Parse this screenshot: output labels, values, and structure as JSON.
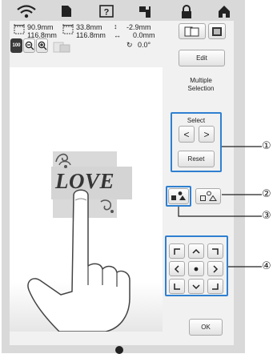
{
  "status_bar": {
    "icons": [
      "wifi-icon",
      "page-icon",
      "help-icon",
      "thread-icon",
      "lock-icon",
      "home-icon"
    ]
  },
  "info": {
    "width_label": "90.9mm",
    "height_label": "116.8mm",
    "width2_label": "33.8mm",
    "height2_label": "116.8mm",
    "offset_y": "-2.9mm",
    "offset_x": "0.0mm",
    "rotation": "0.0°"
  },
  "zoom": {
    "level_label": "100"
  },
  "buttons": {
    "edit": "Edit",
    "multiple_selection": "Multiple\nSelection",
    "select_title": "Select",
    "prev": "<",
    "next": ">",
    "reset": "Reset",
    "ok": "OK"
  },
  "design": {
    "text": "LOVE"
  },
  "callouts": [
    "①",
    "②",
    "③",
    "④"
  ],
  "colors": {
    "accent_border": "#2f80d1",
    "screen_bg": "#f1f1f1",
    "frame": "#d9d9d9"
  }
}
